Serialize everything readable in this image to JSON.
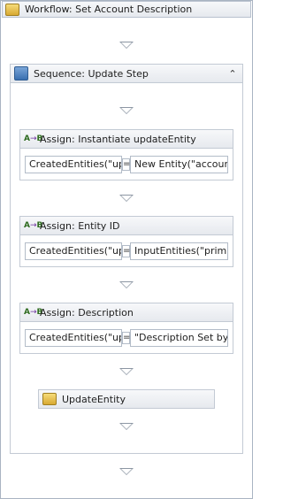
{
  "workflow": {
    "title": "Workflow: Set Account Description",
    "icon": "workflow-folder-icon"
  },
  "sequence": {
    "title": "Sequence: Update Step",
    "icon": "sequence-icon",
    "collapse": "collapse-chevron-icon"
  },
  "assigns": [
    {
      "title": "Assign: Instantiate updateEntity",
      "to": "CreatedEntities(\"up",
      "value": "New Entity(\"accoun"
    },
    {
      "title": "Assign: Entity ID",
      "to": "CreatedEntities(\"up",
      "value": "InputEntities(\"prim"
    },
    {
      "title": "Assign: Description",
      "to": "CreatedEntities(\"up",
      "value": "\"Description Set by"
    }
  ],
  "assign_icon": {
    "a": "A",
    "arrow": "→",
    "b": "B"
  },
  "equals": "=",
  "update_entity": {
    "label": "UpdateEntity",
    "icon": "update-entity-icon"
  }
}
